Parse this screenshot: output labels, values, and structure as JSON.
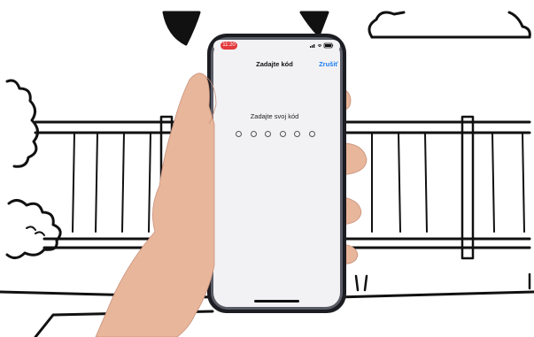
{
  "status_bar": {
    "time": "11:20"
  },
  "screen": {
    "title": "Zadajte kód",
    "cancel_label": "Zrušiť",
    "prompt": "Zadajte svoj kód",
    "pin_length": 6
  },
  "colors": {
    "accent": "#1a7cf0",
    "status_pill": "#e5383b",
    "screen_bg": "#f2f2f4",
    "phone_body": "#1c1d22"
  },
  "icons": [
    "signal-icon",
    "wifi-icon",
    "battery-icon"
  ]
}
